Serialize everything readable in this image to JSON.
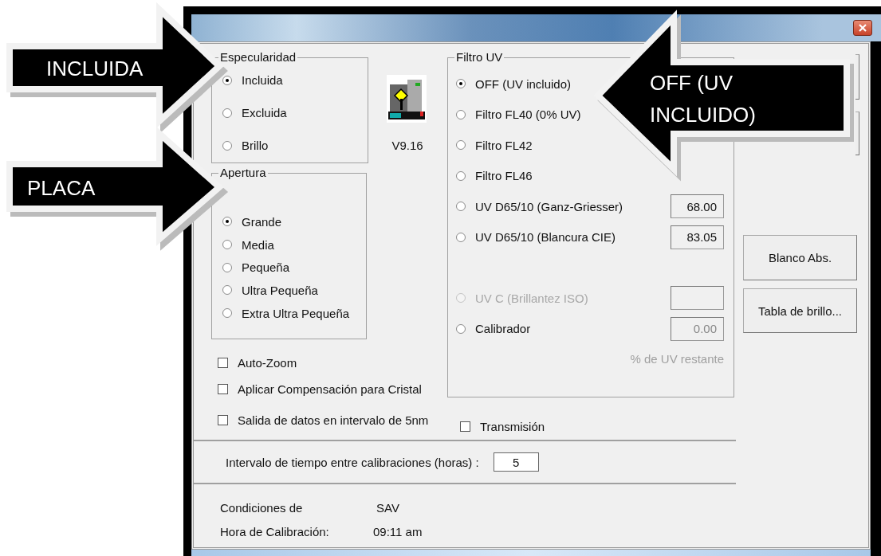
{
  "especularidad": {
    "title": "Especularidad",
    "options": [
      {
        "label": "Incluida",
        "selected": true
      },
      {
        "label": "Excluida",
        "selected": false
      },
      {
        "label": "Brillo",
        "selected": false
      }
    ]
  },
  "version": "V9.16",
  "apertura": {
    "title": "Apertura",
    "options": [
      {
        "label": "Grande",
        "selected": true
      },
      {
        "label": "Media",
        "selected": false
      },
      {
        "label": "Pequeña",
        "selected": false
      },
      {
        "label": "Ultra Pequeña",
        "selected": false
      },
      {
        "label": "Extra Ultra Pequeña",
        "selected": false
      }
    ]
  },
  "checkboxes": [
    {
      "label": "Auto-Zoom",
      "checked": false
    },
    {
      "label": "Aplicar Compensación para Cristal",
      "checked": false
    }
  ],
  "filtro_uv": {
    "title": "Filtro UV",
    "options": [
      {
        "label": "OFF (UV incluido)",
        "selected": true,
        "disabled": false
      },
      {
        "label": "Filtro FL40 (0% UV)",
        "selected": false,
        "disabled": false
      },
      {
        "label": "Filtro FL42",
        "selected": false,
        "disabled": false
      },
      {
        "label": "Filtro FL46",
        "selected": false,
        "disabled": false
      },
      {
        "label": "UV D65/10 (Ganz-Griesser)",
        "selected": false,
        "disabled": false,
        "value": "68.00"
      },
      {
        "label": "UV D65/10 (Blancura CIE)",
        "selected": false,
        "disabled": false,
        "value": "83.05"
      }
    ],
    "extra_options": [
      {
        "label": "UV C (Brillantez ISO)",
        "selected": false,
        "disabled": true
      },
      {
        "label": "Calibrador",
        "selected": false,
        "disabled": false,
        "value": "0.00"
      }
    ],
    "caption": "% de UV restante"
  },
  "buttons": [
    "Blanco Abs.",
    "Tabla de brillo..."
  ],
  "bottom_checkboxes": [
    {
      "label": "Salida de datos en intervalo de 5nm",
      "checked": false
    },
    {
      "label": "Transmisión",
      "checked": false
    }
  ],
  "interval": {
    "label": "Intervalo de tiempo entre calibraciones (horas) :",
    "value": "5"
  },
  "info": [
    {
      "label": "Condiciones de",
      "value": "SAV"
    },
    {
      "label": "Hora de Calibración:",
      "value": "09:11 am"
    }
  ],
  "callouts": [
    {
      "text": "INCLUIDA"
    },
    {
      "text": "PLACA"
    },
    {
      "text": "OFF (UV INCLUIDO)"
    }
  ]
}
